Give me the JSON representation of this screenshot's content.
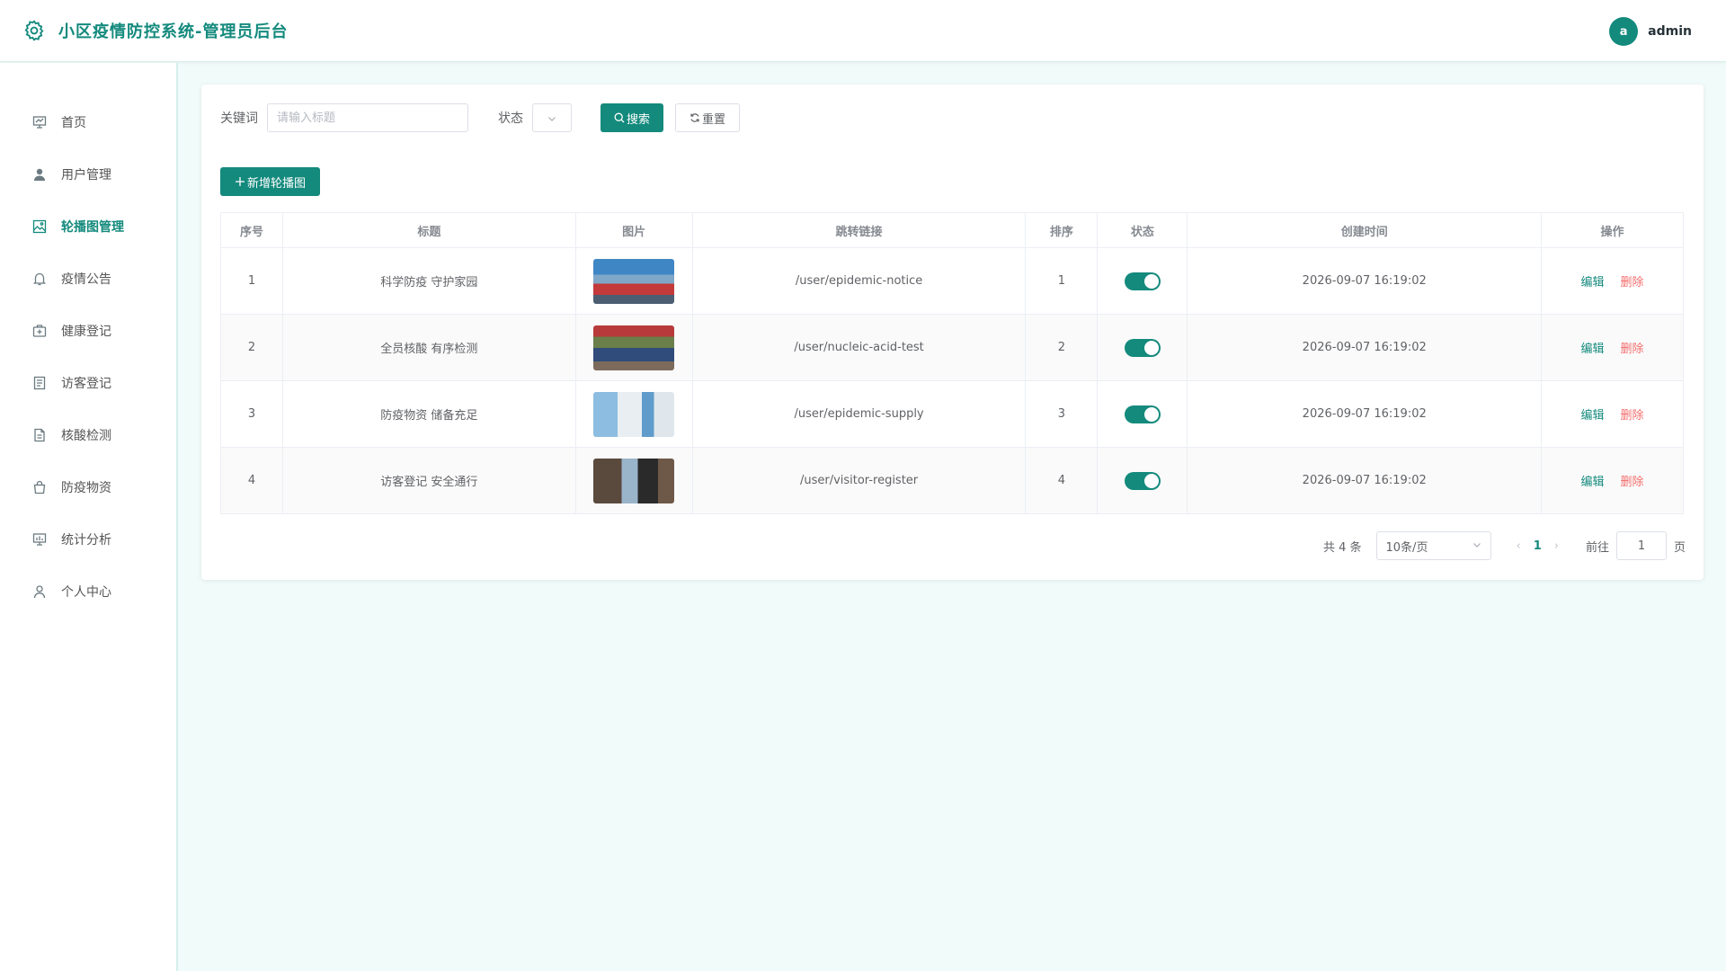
{
  "header": {
    "title": "小区疫情防控系统-管理员后台",
    "avatar_letter": "a",
    "username": "admin"
  },
  "sidebar": {
    "items": [
      {
        "label": "首页",
        "icon": "dashboard-icon"
      },
      {
        "label": "用户管理",
        "icon": "user-icon"
      },
      {
        "label": "轮播图管理",
        "icon": "image-icon",
        "active": true
      },
      {
        "label": "疫情公告",
        "icon": "bell-icon"
      },
      {
        "label": "健康登记",
        "icon": "first-aid-icon"
      },
      {
        "label": "访客登记",
        "icon": "document-icon"
      },
      {
        "label": "核酸检测",
        "icon": "file-icon"
      },
      {
        "label": "防疫物资",
        "icon": "bag-icon"
      },
      {
        "label": "统计分析",
        "icon": "chart-icon"
      },
      {
        "label": "个人中心",
        "icon": "person-icon"
      }
    ]
  },
  "search": {
    "keyword_label": "关键词",
    "keyword_placeholder": "请输入标题",
    "keyword_value": "",
    "status_label": "状态",
    "search_label": "搜索",
    "reset_label": "重置"
  },
  "toolbar": {
    "add_label": "新增轮播图"
  },
  "table": {
    "columns": [
      "序号",
      "标题",
      "图片",
      "跳转链接",
      "排序",
      "状态",
      "创建时间",
      "操作"
    ],
    "rows": [
      {
        "index": "1",
        "title": "科学防疫 守护家园",
        "link": "/user/epidemic-notice",
        "sort": "1",
        "enabled": true,
        "created": "2026-09-07 16:19:02",
        "thumb_colors": [
          "#3f86c4",
          "#c33a3a"
        ]
      },
      {
        "index": "2",
        "title": "全员核酸 有序检测",
        "link": "/user/nucleic-acid-test",
        "sort": "2",
        "enabled": true,
        "created": "2026-09-07 16:19:02",
        "thumb_colors": [
          "#b83a3a",
          "#2f4c7a"
        ]
      },
      {
        "index": "3",
        "title": "防疫物资 储备充足",
        "link": "/user/epidemic-supply",
        "sort": "3",
        "enabled": true,
        "created": "2026-09-07 16:19:02",
        "thumb_colors": [
          "#8dbde0",
          "#e8eef2"
        ]
      },
      {
        "index": "4",
        "title": "访客登记 安全通行",
        "link": "/user/visitor-register",
        "sort": "4",
        "enabled": true,
        "created": "2026-09-07 16:19:02",
        "thumb_colors": [
          "#5a4a3e",
          "#9ab4c9"
        ]
      }
    ],
    "edit_label": "编辑",
    "delete_label": "删除"
  },
  "pagination": {
    "total_text": "共 4 条",
    "page_size": "10条/页",
    "current_page": "1",
    "goto_label": "前往",
    "goto_value": "1",
    "page_suffix": "页"
  },
  "colors": {
    "accent": "#148a7d",
    "danger": "#f56c6c",
    "background": "#f1fbf9"
  }
}
